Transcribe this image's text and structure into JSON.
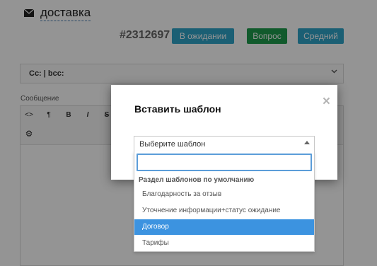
{
  "ticket": {
    "subject": "доставка",
    "id": "#2312697",
    "status_badge": "В ожидании",
    "type_badge": "Вопрос",
    "priority_badge": "Средний",
    "colors": {
      "status": "#2fa4c9",
      "type": "#1e9b4c",
      "priority": "#2fa4c9"
    }
  },
  "compose": {
    "cc_label": "Cc: | bcc:",
    "message_label": "Сообщение",
    "toolbar": {
      "code": "<>",
      "paragraph": "¶",
      "bold": "B",
      "italic": "I",
      "strike": "S",
      "settings": "⚙"
    }
  },
  "modal": {
    "title": "Вставить шаблон",
    "close": "×",
    "select": {
      "placeholder": "Выберите шаблон",
      "search_value": "",
      "group": "Раздел шаблонов по умолчанию",
      "options": [
        "Благодарность за отзыв",
        "Уточнение информации+статус ожидание",
        "Договор",
        "Тарифы"
      ],
      "highlighted_index": 2,
      "highlight_color": "#3c93e0"
    }
  },
  "icons": {
    "subject": "envelope-icon",
    "dropdown": "caret-up-icon",
    "cc": "chevron-down-icon"
  }
}
